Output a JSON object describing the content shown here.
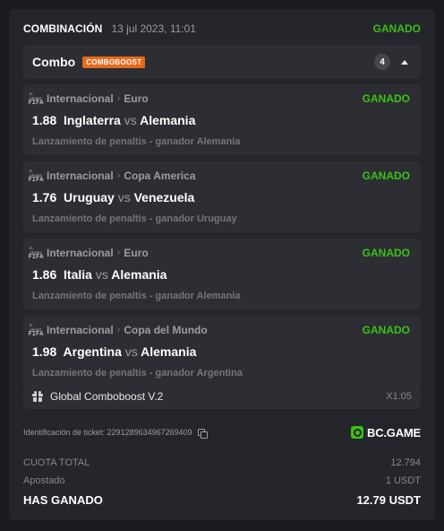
{
  "header": {
    "title": "COMBINACIÓN",
    "date": "13 jul 2023, 11:01",
    "status": "GANADO"
  },
  "combo": {
    "label": "Combo",
    "badge": "COMBOBOOST",
    "count": "4",
    "collapse_icon": "chevron-up-icon"
  },
  "legs": [
    {
      "league_logo": "FIFA",
      "category": "Internacional",
      "tournament": "Euro",
      "status": "GANADO",
      "odds": "1.88",
      "home": "Inglaterra",
      "vs": "vs",
      "away": "Alemania",
      "selection": "Lanzamiento de penaltis - ganador Alemania"
    },
    {
      "league_logo": "FIFA",
      "category": "Internacional",
      "tournament": "Copa America",
      "status": "GANADO",
      "odds": "1.76",
      "home": "Uruguay",
      "vs": "vs",
      "away": "Venezuela",
      "selection": "Lanzamiento de penaltis - ganador Uruguay"
    },
    {
      "league_logo": "FIFA",
      "category": "Internacional",
      "tournament": "Euro",
      "status": "GANADO",
      "odds": "1.86",
      "home": "Italia",
      "vs": "vs",
      "away": "Alemania",
      "selection": "Lanzamiento de penaltis - ganador Alemania"
    },
    {
      "league_logo": "FIFA",
      "category": "Internacional",
      "tournament": "Copa del Mundo",
      "status": "GANADO",
      "odds": "1.98",
      "home": "Argentina",
      "vs": "vs",
      "away": "Alemania",
      "selection": "Lanzamiento de penaltis - ganador Argentina"
    }
  ],
  "boost": {
    "icon": "gift-icon",
    "name": "Global Comboboost V.2",
    "multiplier": "X1.05"
  },
  "ticket": {
    "label": "Identificación de ticket: 2291289634967269409",
    "copy_icon": "copy-icon"
  },
  "brand": {
    "name": "BC.GAME"
  },
  "summary": {
    "total_odds_label": "CUOTA TOTAL",
    "total_odds": "12.794",
    "stake_label": "Apostado",
    "stake": "1 USDT",
    "won_label": "HAS GANADO",
    "won": "12.79 USDT"
  },
  "colors": {
    "win": "#3bc117",
    "boost_badge": "#e76a1c",
    "background": "#24262b"
  }
}
